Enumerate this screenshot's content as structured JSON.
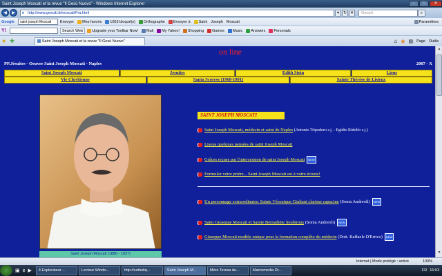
{
  "window": {
    "title": "Saint Joseph Moscati et la revue \"Il Gesù Nuovo\" - Windows Internet Explorer",
    "min": "–",
    "max": "□",
    "close": "✕"
  },
  "address": {
    "url": "http://www.gesuiti.it/moscati/Fra.html",
    "search_placeholder": "Google"
  },
  "google_toolbar": {
    "brand": "Google",
    "query": "saint joseph Moscati",
    "send": "Envoyer",
    "favorites": "Mes favoris",
    "blocked": "1053 bloqué(s)",
    "spell": "Orthographe",
    "send_to": "Envoyer à",
    "chips": [
      "Saint",
      "Joseph",
      "Moscati"
    ],
    "settings": "Paramètres"
  },
  "yahoo_toolbar": {
    "brand": "Y!",
    "search_web": "Search Web",
    "upgrade": "Upgrade your Toolbar Now!",
    "mail": "Mail",
    "my_yahoo": "My Yahoo!",
    "shopping": "Shopping",
    "games": "Games",
    "music": "Music",
    "answers": "Answers",
    "personals": "Personals"
  },
  "tabs": {
    "active": "Saint Joseph Moscati et la revue \"Il Gesù Nuovo\"",
    "page_menu": "Page",
    "tools_menu": "Outils"
  },
  "page": {
    "online": "on line",
    "org": "PP.Jésuites - Oeuvre Saint Joseph Moscati - Naples",
    "year": "2007 - X",
    "menu_row1": [
      "Saint Joseph Moscati",
      "Jesuites",
      "Edith Stein",
      "Liens"
    ],
    "menu_row2": [
      "Vie Chrétienne",
      "Santa Scorese (1968-1991)",
      "Sainte Thérèse de Lisieux"
    ],
    "photo_caption": "Saint Joseph Moscati (1880 - 1927)",
    "section_title": "SAINT JOSEPH MOSCATI",
    "items": [
      {
        "link": "Saint Joseph Moscati, médecin et saint de Naples",
        "extra": "(Antonio Tripodoro s.j. - Egidio Ridolfo s.j.)",
        "new": ""
      },
      {
        "link": "Lisons quelques pensées de saint Joseph Moscati",
        "extra": "",
        "new": ""
      },
      {
        "link": "Grâces reçues par l'intercession de saint Joseph Moscati",
        "extra": "",
        "new": "NEW"
      },
      {
        "link": "Formulez votre prière... Saint Joseph Moscati est à votre écoute!",
        "extra": "",
        "new": ""
      }
    ],
    "items2": [
      {
        "link": "Un personnage extraordinaire: Sainte Véronique Giuliani clarisse capucine",
        "extra": "(Sonia Andreoli)",
        "new": "NEW"
      },
      {
        "link": "Saint Giuseppe Moscati et Sainte Bernadette Soubirous",
        "extra": "(Sonia Andreoli)",
        "new": "NEW"
      },
      {
        "link": "Giuseppe Moscati modèle unique pour la formation complète du médecin",
        "extra": "(Dott. Raffaele D'Errico)",
        "new": "NEW"
      }
    ]
  },
  "status": {
    "zone": "Internet | Mode protégé : activé",
    "zoom": "100%"
  },
  "taskbar": {
    "tasks": [
      "4 Explorateur ...",
      "Lecteur Windo...",
      "http://catholiq...",
      "Saint Joseph M...",
      "Mère Teresa de...",
      "Macromedia Dr..."
    ],
    "lang": "FR",
    "time": "16:03"
  },
  "colors": {
    "page_bg": "#10209a",
    "menu_bg": "#f5e21a",
    "link": "#ffff40",
    "online": "#ff2020"
  }
}
